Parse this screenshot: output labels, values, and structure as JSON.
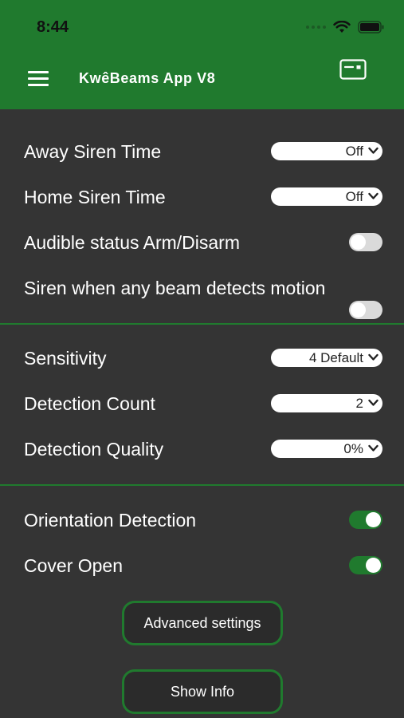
{
  "status_bar": {
    "time": "8:44",
    "icons": [
      "signal-dots-icon",
      "wifi-icon",
      "battery-icon"
    ]
  },
  "header": {
    "title": "KwêBeams App V8",
    "menu_icon": "hamburger-menu-icon",
    "right_icon": "card-icon"
  },
  "siren": {
    "away_label": "Away Siren Time",
    "away_value": "Off",
    "home_label": "Home Siren Time",
    "home_value": "Off",
    "audible_label": "Audible status Arm/Disarm",
    "audible_on": false,
    "any_beam_label": "Siren when any beam detects motion",
    "any_beam_on": false
  },
  "detection": {
    "sensitivity_label": "Sensitivity",
    "sensitivity_value": "4 Default",
    "count_label": "Detection Count",
    "count_value": "2",
    "quality_label": "Detection Quality",
    "quality_value": "0%"
  },
  "tamper": {
    "orientation_label": "Orientation Detection",
    "orientation_on": true,
    "cover_label": "Cover Open",
    "cover_on": true
  },
  "buttons": {
    "advanced": "Advanced settings",
    "info": "Show Info"
  },
  "colors": {
    "accent": "#207a2e",
    "background": "#343434",
    "text": "#ffffff"
  }
}
